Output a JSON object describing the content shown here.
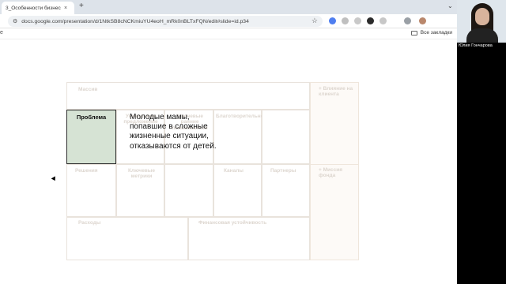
{
  "browser": {
    "tab_title": "3_Особенности бизнес-мо",
    "tab_close": "×",
    "new_tab": "+",
    "tab_chevron": "⌄",
    "url": "docs.google.com/presentation/d/1NtkSB8cNCKmiuYU4eoH_mRk0nBLTxFQN/edit#slide=id.p34",
    "all_bookmarks": "Все закладки",
    "extensions": [
      {
        "name": "extension-1",
        "color": "#4f7ef0"
      },
      {
        "name": "extension-2",
        "color": "#bfbfbf"
      },
      {
        "name": "extension-3",
        "color": "#c9c9c9"
      },
      {
        "name": "extension-4",
        "color": "#2b2b2b"
      },
      {
        "name": "extension-5",
        "color": "#c7c7c7"
      },
      {
        "name": "extension-6",
        "color": "#9aa0a6"
      },
      {
        "name": "profile-avatar",
        "color": "#b9876c"
      }
    ]
  },
  "canvas": {
    "segments_label": "Массив",
    "problem_label": "Проблема",
    "problem_text": "Молодые мамы, попавшие в сложные жизненные ситуации, отказываются от детей.",
    "value_label": "Уникальное предложение",
    "early_adopters_label": "Ключевые ранние пользователи",
    "advantage_label": "Благотворительность",
    "solution_label": "Решения",
    "key_metrics_label": "Ключевые метрики",
    "channels_label": "Каналы",
    "partners_label": "Партнеры",
    "costs_label": "Расходы",
    "sustainability_label": "Финансовая устойчивость",
    "right_top_label": "+ Влияние на клиента",
    "right_bottom_label": "+ Миссия фонда"
  },
  "webcam": {
    "name": "Юлия Гончарова"
  }
}
